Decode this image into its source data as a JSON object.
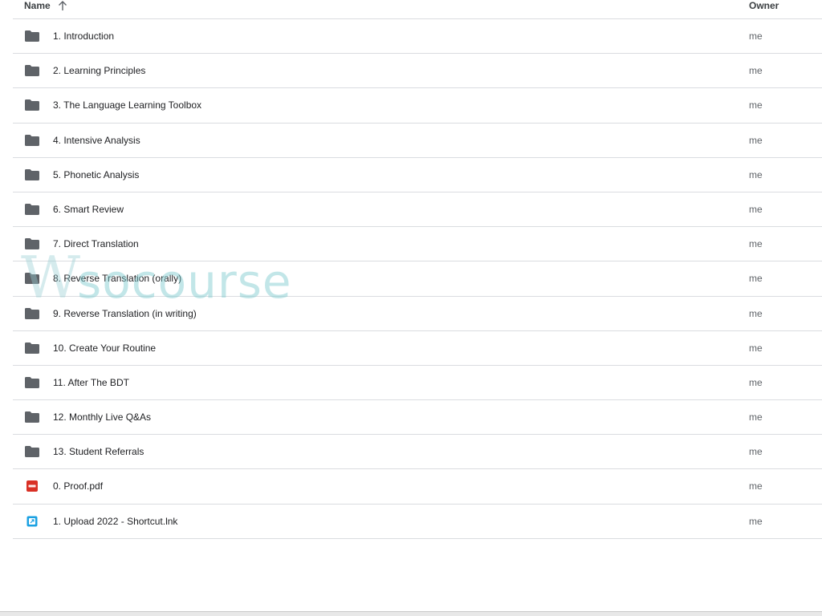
{
  "header": {
    "name_label": "Name",
    "owner_label": "Owner",
    "sort_icon": "arrow-up-icon"
  },
  "colors": {
    "folder": "#5f6368",
    "pdf": "#d93025",
    "shortcut": "#1ba1e2",
    "divider": "#dadce0"
  },
  "files": [
    {
      "name": "1. Introduction",
      "owner": "me",
      "type": "folder"
    },
    {
      "name": "2. Learning Principles",
      "owner": "me",
      "type": "folder"
    },
    {
      "name": "3. The Language Learning Toolbox",
      "owner": "me",
      "type": "folder"
    },
    {
      "name": "4. Intensive Analysis",
      "owner": "me",
      "type": "folder"
    },
    {
      "name": "5. Phonetic Analysis",
      "owner": "me",
      "type": "folder"
    },
    {
      "name": "6. Smart Review",
      "owner": "me",
      "type": "folder"
    },
    {
      "name": "7. Direct Translation",
      "owner": "me",
      "type": "folder"
    },
    {
      "name": "8. Reverse Translation (orally)",
      "owner": "me",
      "type": "folder"
    },
    {
      "name": "9. Reverse Translation (in writing)",
      "owner": "me",
      "type": "folder"
    },
    {
      "name": "10. Create Your Routine",
      "owner": "me",
      "type": "folder"
    },
    {
      "name": "11. After The BDT",
      "owner": "me",
      "type": "folder"
    },
    {
      "name": "12. Monthly Live Q&As",
      "owner": "me",
      "type": "folder"
    },
    {
      "name": "13. Student Referrals",
      "owner": "me",
      "type": "folder"
    },
    {
      "name": "0. Proof.pdf",
      "owner": "me",
      "type": "pdf"
    },
    {
      "name": "1. Upload 2022 - Shortcut.lnk",
      "owner": "me",
      "type": "shortcut"
    }
  ],
  "watermark": {
    "text": "socourse",
    "mark": "W"
  }
}
